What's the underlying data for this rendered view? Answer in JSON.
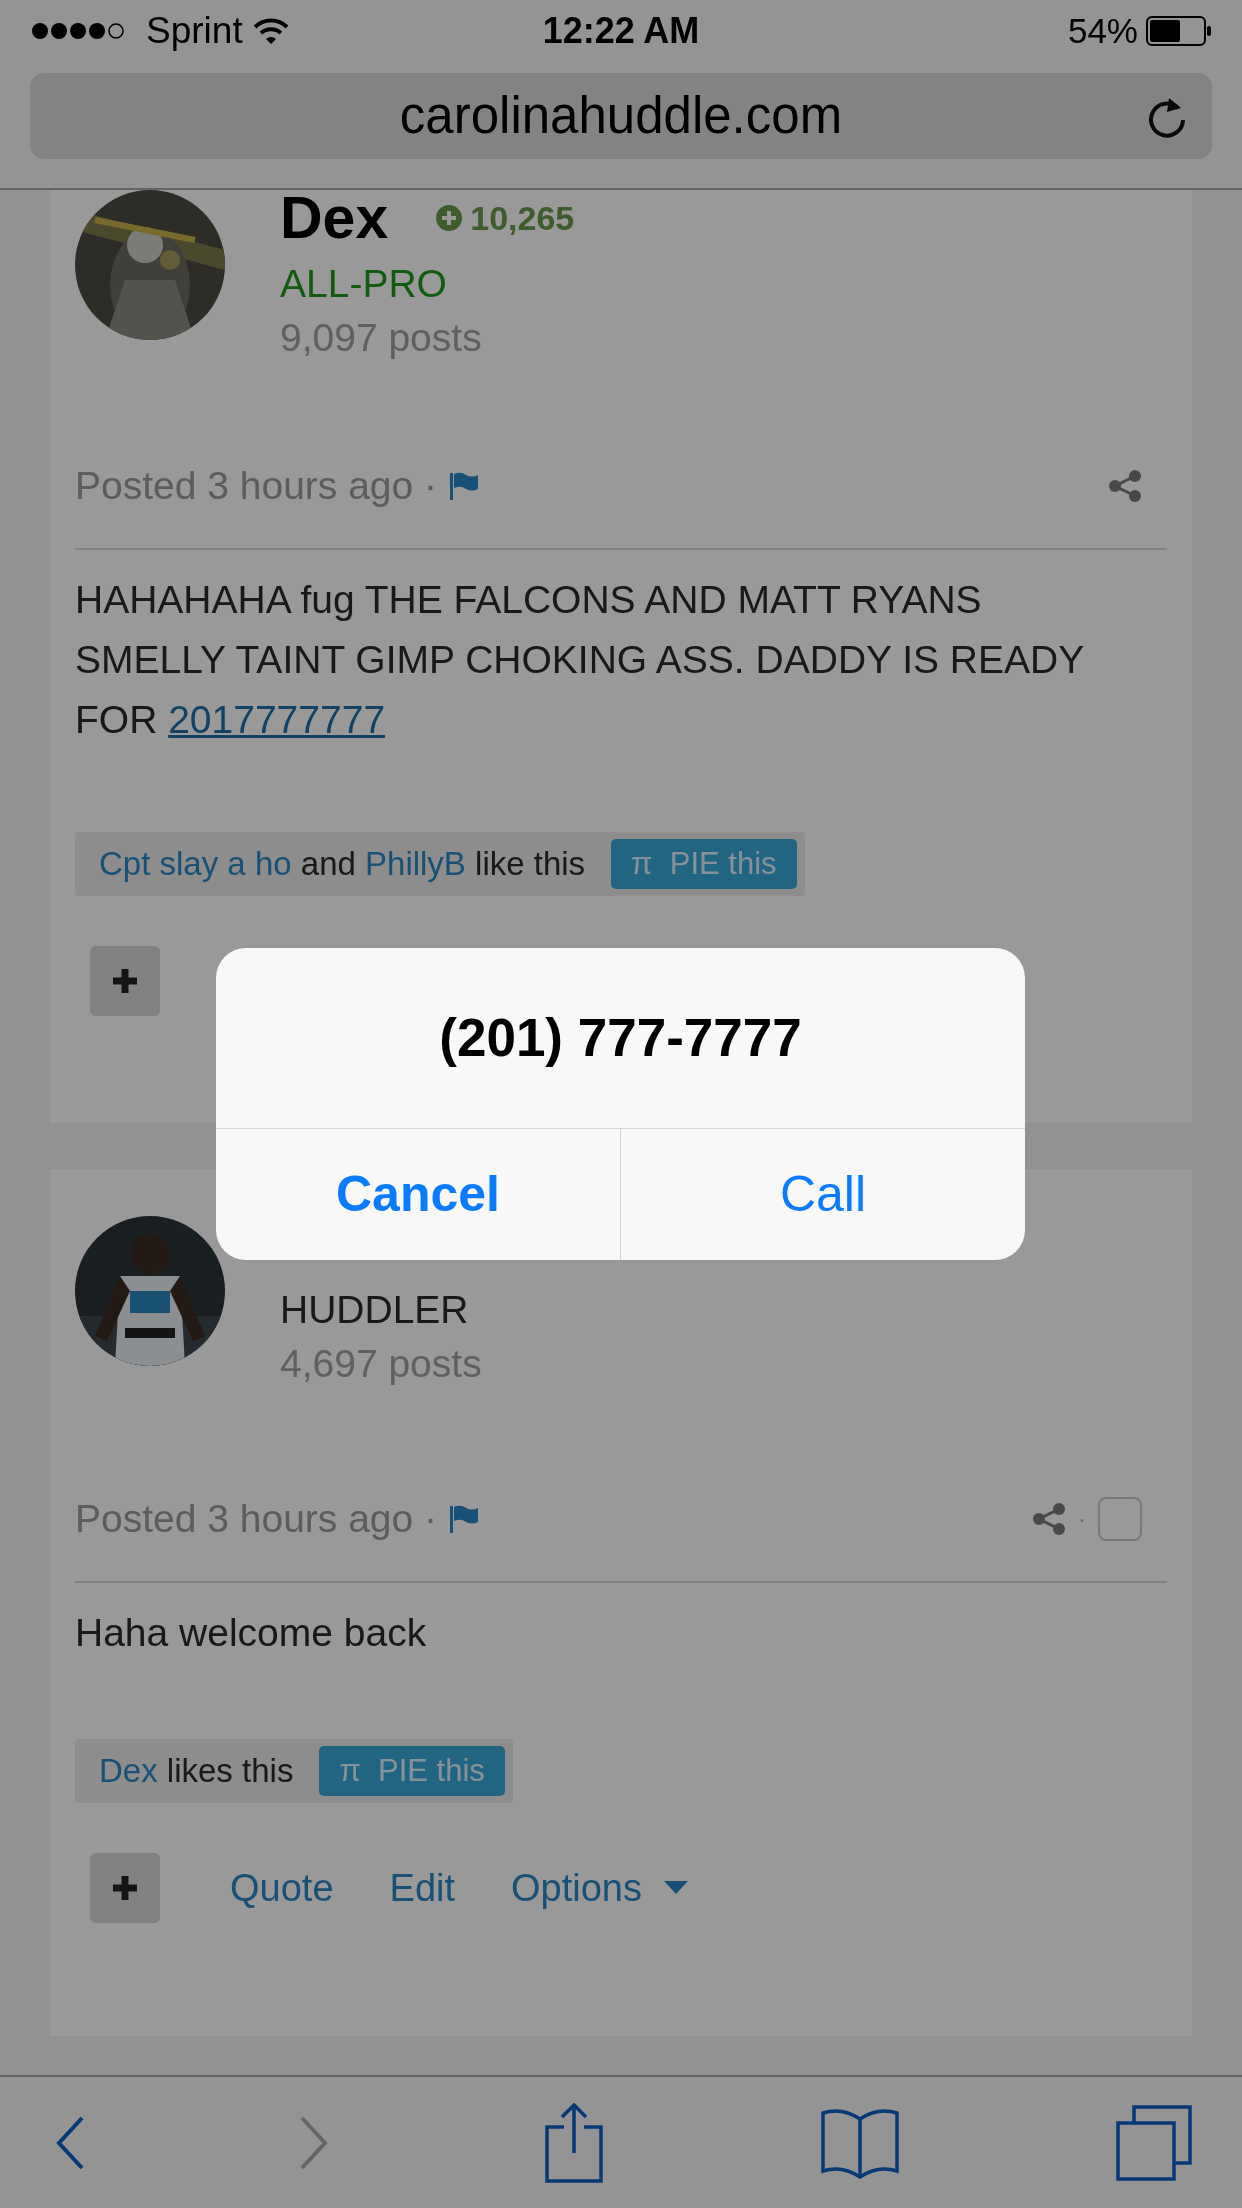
{
  "status_bar": {
    "carrier": "Sprint",
    "time": "12:22 AM",
    "battery": "54%"
  },
  "address_bar": {
    "url": "carolinahuddle.com"
  },
  "posts": [
    {
      "author": "Dex",
      "reputation": "10,265",
      "rank": {
        "text": "ALL-PRO",
        "kind": "elite"
      },
      "post_count": "9,097 posts",
      "posted": "Posted 3 hours ago ·",
      "body": [
        {
          "kind": "text",
          "text": "HAHAHAHA fug THE FALCONS AND MATT RYANS SMELLY TAINT GIMP CHOKING ASS. DADDY IS READY FOR "
        },
        {
          "kind": "link",
          "text": "2017777777"
        }
      ],
      "likes": [
        {
          "kind": "link",
          "text": "Cpt slay a ho"
        },
        {
          "kind": "text",
          "text": " and "
        },
        {
          "kind": "link",
          "text": "PhillyB"
        },
        {
          "kind": "text",
          "text": " like this"
        }
      ],
      "pie": {
        "symbol": "π",
        "label": "PIE this"
      }
    },
    {
      "rank": {
        "text": "HUDDLER",
        "kind": "member"
      },
      "post_count": "4,697 posts",
      "posted": "Posted 3 hours ago ·",
      "share_separator": "·",
      "checkbox": {
        "checked": false
      },
      "body": [
        {
          "kind": "text",
          "text": "Haha welcome back"
        }
      ],
      "likes": [
        {
          "kind": "link",
          "text": "Dex"
        },
        {
          "kind": "text",
          "text": " likes this"
        }
      ],
      "pie": {
        "symbol": "π",
        "label": "PIE this"
      },
      "actions": [
        {
          "kind": "link",
          "label": "Quote"
        },
        {
          "kind": "link",
          "label": "Edit"
        },
        {
          "kind": "menu",
          "label": "Options"
        }
      ]
    }
  ],
  "dialog": {
    "title": "(201) 777-7777",
    "buttons": [
      {
        "label": "Cancel",
        "emphasized": true
      },
      {
        "label": "Call",
        "emphasized": false
      }
    ]
  },
  "toolbar": [
    {
      "kind": "back",
      "disabled": false
    },
    {
      "kind": "forward",
      "disabled": true
    },
    {
      "kind": "share",
      "disabled": false
    },
    {
      "kind": "bookmarks",
      "disabled": false
    },
    {
      "kind": "tabs",
      "disabled": false
    }
  ]
}
